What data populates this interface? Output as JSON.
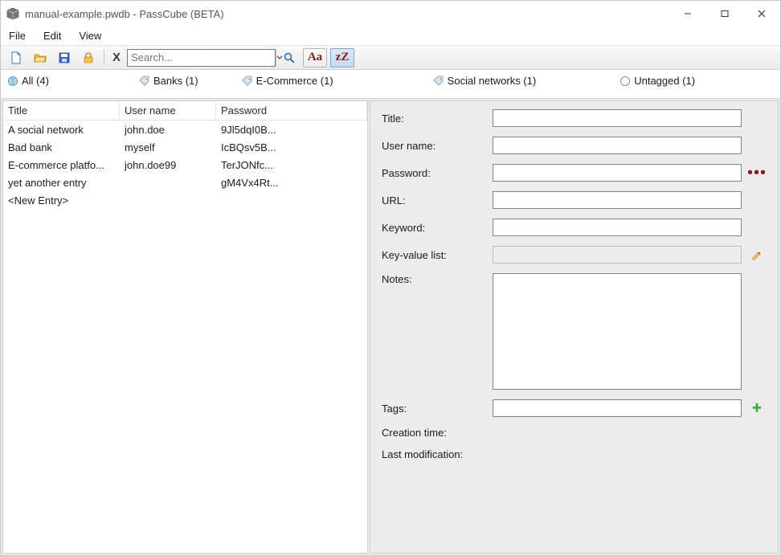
{
  "window": {
    "title": "manual-example.pwdb - PassCube (BETA)"
  },
  "menu": {
    "file": "File",
    "edit": "Edit",
    "view": "View"
  },
  "toolbar": {
    "search_placeholder": "Search...",
    "aa": "Aa",
    "zz": "zZ"
  },
  "filters": {
    "all": {
      "label": "All (4)"
    },
    "banks": {
      "label": "Banks (1)"
    },
    "ecom": {
      "label": "E-Commerce (1)"
    },
    "social": {
      "label": "Social networks (1)"
    },
    "untagged": {
      "label": "Untagged (1)"
    }
  },
  "list": {
    "headers": {
      "title": "Title",
      "user": "User name",
      "pwd": "Password"
    },
    "rows": [
      {
        "title": "A social network",
        "user": "john.doe",
        "pwd": "9Jl5dqI0B..."
      },
      {
        "title": "Bad bank",
        "user": "myself",
        "pwd": "IcBQsv5B..."
      },
      {
        "title": "E-commerce platfo...",
        "user": "john.doe99",
        "pwd": "TerJONfc..."
      },
      {
        "title": "yet another entry",
        "user": "",
        "pwd": "gM4Vx4Rt..."
      },
      {
        "title": "<New Entry>",
        "user": "",
        "pwd": ""
      }
    ]
  },
  "details": {
    "labels": {
      "title": "Title:",
      "user": "User name:",
      "pwd": "Password:",
      "url": "URL:",
      "keyword": "Keyword:",
      "kvl": "Key-value list:",
      "notes": "Notes:",
      "tags": "Tags:",
      "ctime": "Creation time:",
      "mtime": "Last modification:"
    },
    "values": {
      "title": "",
      "user": "",
      "pwd": "",
      "url": "",
      "keyword": "",
      "kvl": "",
      "notes": "",
      "tags": "",
      "ctime": "",
      "mtime": ""
    }
  }
}
